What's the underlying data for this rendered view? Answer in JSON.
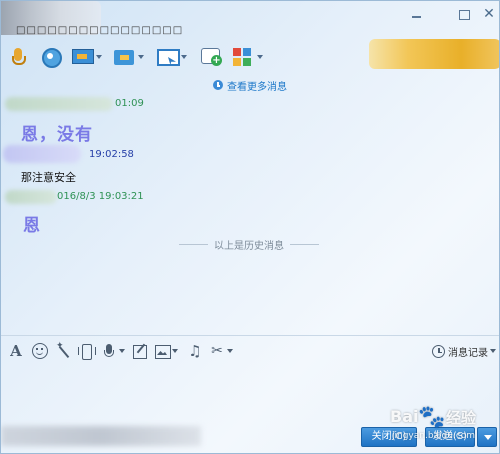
{
  "window": {
    "title_placeholder": "□□□□□□□□□□□□□□□□"
  },
  "toolbar_top": {
    "items": [
      {
        "name": "voice-call",
        "icon": "microphone-icon",
        "has_menu": false
      },
      {
        "name": "video-call",
        "icon": "webcam-icon",
        "has_menu": false
      },
      {
        "name": "screen-share",
        "icon": "screen-share-icon",
        "has_menu": true
      },
      {
        "name": "file-transfer",
        "icon": "folder-transfer-icon",
        "has_menu": true
      },
      {
        "name": "remote-desktop",
        "icon": "remote-desktop-icon",
        "has_menu": true
      },
      {
        "name": "create-group-chat",
        "icon": "chat-add-icon",
        "has_menu": false
      },
      {
        "name": "apps",
        "icon": "apps-grid-icon",
        "has_menu": true
      }
    ]
  },
  "chat": {
    "more_history_label": "查看更多消息",
    "messages": [
      {
        "time": "01:09",
        "time_color": "#2f9255",
        "text": "恩，没有",
        "style": "big"
      },
      {
        "time": "19:02:58",
        "time_color": "#2740a8",
        "text": "那注意安全",
        "style": "plain"
      },
      {
        "time": "016/8/3 19:03:21",
        "time_color": "#2f9255",
        "text": "恩",
        "style": "big"
      }
    ],
    "history_divider": "以上是历史消息"
  },
  "toolbar_bottom": {
    "history_record_label": "消息记录"
  },
  "actions": {
    "close_label": "关闭(C)",
    "send_label": "发送(S)"
  },
  "watermark": {
    "brand": "Bai",
    "brand_cn": "经验",
    "url": "jingyan.baidu.com"
  },
  "colors": {
    "accent": "#1f73c4",
    "link": "#1d78c9",
    "message_highlight": "#7a7ae6"
  }
}
